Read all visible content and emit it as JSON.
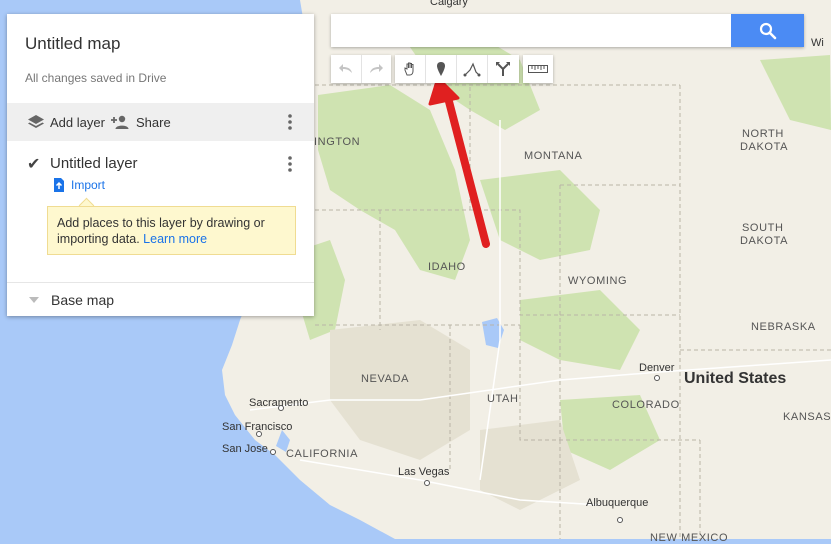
{
  "panel": {
    "map_title": "Untitled map",
    "saved_status": "All changes saved in Drive",
    "add_layer_label": "Add layer",
    "share_label": "Share",
    "layer": {
      "title": "Untitled layer",
      "checked": true,
      "import_label": "Import"
    },
    "tooltip": {
      "text": "Add places to this layer by drawing or importing data.",
      "link": "Learn more"
    },
    "base_map_label": "Base map"
  },
  "search": {
    "value": "",
    "placeholder": ""
  },
  "toolbar": {
    "icons": [
      "undo-icon",
      "redo-icon",
      "hand-icon",
      "marker-icon",
      "draw-line-icon",
      "directions-icon",
      "ruler-icon"
    ]
  },
  "map": {
    "labels": {
      "calgary": "Calgary",
      "washington": "INGTON",
      "montana": "MONTANA",
      "north_dakota_1": "NORTH",
      "north_dakota_2": "DAKOTA",
      "south_dakota_1": "SOUTH",
      "south_dakota_2": "DAKOTA",
      "idaho": "IDAHO",
      "wyoming": "WYOMING",
      "nebraska": "NEBRASKA",
      "nevada": "NEVADA",
      "utah": "UTAH",
      "colorado": "COLORADO",
      "kansas": "KANSAS",
      "california": "CALIFORNIA",
      "denver": "Denver",
      "united_states": "United States",
      "sacramento": "Sacramento",
      "san_francisco": "San Francisco",
      "san_jose": "San Jose",
      "las_vegas": "Las Vegas",
      "albuquerque": "Albuquerque",
      "winnipeg_partial": "Wi",
      "new_mexico": "NEW MEXICO"
    },
    "colors": {
      "land": "#f2efe6",
      "water": "#a9c9f8",
      "forest": "#cfe3b1",
      "arrow": "#e02020",
      "accent": "#4b8bf4"
    }
  }
}
